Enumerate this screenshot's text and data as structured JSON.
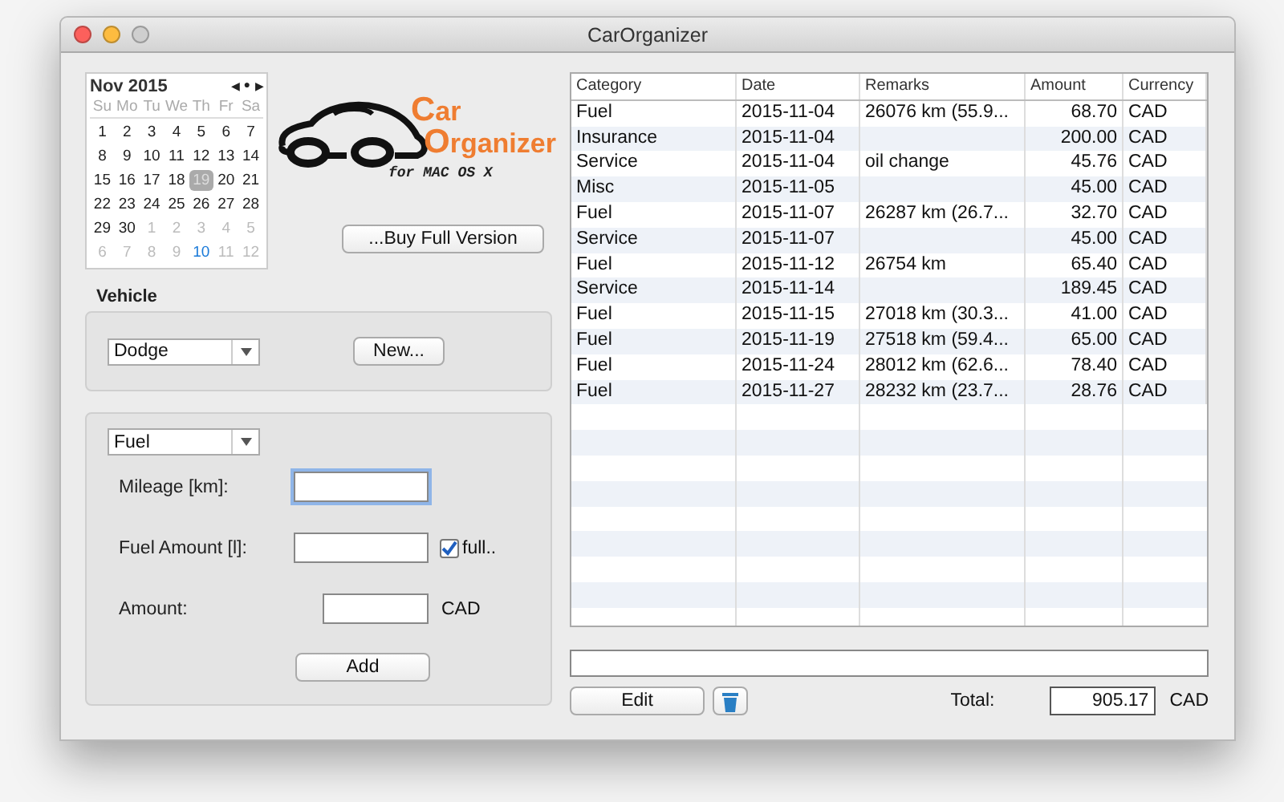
{
  "window": {
    "title": "CarOrganizer"
  },
  "calendar": {
    "month": "Nov 2015",
    "nav": [
      "◀",
      "●",
      "▶"
    ],
    "weekdays": [
      "Su",
      "Mo",
      "Tu",
      "We",
      "Th",
      "Fr",
      "Sa"
    ],
    "weeks": [
      [
        {
          "label": "1",
          "kind": "in",
          "selected": false
        },
        {
          "label": "2",
          "kind": "in",
          "selected": false
        },
        {
          "label": "3",
          "kind": "in",
          "selected": false
        },
        {
          "label": "4",
          "kind": "in",
          "selected": false
        },
        {
          "label": "5",
          "kind": "in",
          "selected": false
        },
        {
          "label": "6",
          "kind": "in",
          "selected": false
        },
        {
          "label": "7",
          "kind": "in",
          "selected": false
        }
      ],
      [
        {
          "label": "8",
          "kind": "in",
          "selected": false
        },
        {
          "label": "9",
          "kind": "in",
          "selected": false
        },
        {
          "label": "10",
          "kind": "in",
          "selected": false
        },
        {
          "label": "11",
          "kind": "in",
          "selected": false
        },
        {
          "label": "12",
          "kind": "in",
          "selected": false
        },
        {
          "label": "13",
          "kind": "in",
          "selected": false
        },
        {
          "label": "14",
          "kind": "in",
          "selected": false
        }
      ],
      [
        {
          "label": "15",
          "kind": "in",
          "selected": false
        },
        {
          "label": "16",
          "kind": "in",
          "selected": false
        },
        {
          "label": "17",
          "kind": "in",
          "selected": false
        },
        {
          "label": "18",
          "kind": "in",
          "selected": false
        },
        {
          "label": "19",
          "kind": "in",
          "selected": true
        },
        {
          "label": "20",
          "kind": "in",
          "selected": false
        },
        {
          "label": "21",
          "kind": "in",
          "selected": false
        }
      ],
      [
        {
          "label": "22",
          "kind": "in",
          "selected": false
        },
        {
          "label": "23",
          "kind": "in",
          "selected": false
        },
        {
          "label": "24",
          "kind": "in",
          "selected": false
        },
        {
          "label": "25",
          "kind": "in",
          "selected": false
        },
        {
          "label": "26",
          "kind": "in",
          "selected": false
        },
        {
          "label": "27",
          "kind": "in",
          "selected": false
        },
        {
          "label": "28",
          "kind": "in",
          "selected": false
        }
      ],
      [
        {
          "label": "29",
          "kind": "in",
          "selected": false
        },
        {
          "label": "30",
          "kind": "in",
          "selected": false
        },
        {
          "label": "1",
          "kind": "out",
          "selected": false
        },
        {
          "label": "2",
          "kind": "out",
          "selected": false
        },
        {
          "label": "3",
          "kind": "out",
          "selected": false
        },
        {
          "label": "4",
          "kind": "out",
          "selected": false
        },
        {
          "label": "5",
          "kind": "out",
          "selected": false
        }
      ],
      [
        {
          "label": "6",
          "kind": "out",
          "selected": false
        },
        {
          "label": "7",
          "kind": "out",
          "selected": false
        },
        {
          "label": "8",
          "kind": "out",
          "selected": false
        },
        {
          "label": "9",
          "kind": "out",
          "selected": false
        },
        {
          "label": "10",
          "kind": "today",
          "selected": false
        },
        {
          "label": "11",
          "kind": "out",
          "selected": false
        },
        {
          "label": "12",
          "kind": "out",
          "selected": false
        }
      ]
    ]
  },
  "logo": {
    "line1": "Car",
    "line2": "Organizer",
    "tagline": "for MAC OS X"
  },
  "buy_button": "...Buy Full Version",
  "vehicle": {
    "title": "Vehicle",
    "selection": "Dodge",
    "new_button": "New..."
  },
  "entry": {
    "category": "Fuel",
    "mileage_label": "Mileage [km]:",
    "fuel_label": "Fuel Amount [l]:",
    "full": {
      "label": "full..",
      "checked": true
    },
    "amount_label": "Amount:",
    "currency": "CAD",
    "add_button": "Add"
  },
  "table": {
    "columns": [
      "Category",
      "Date",
      "Remarks",
      "Amount",
      "Currency"
    ],
    "rows": [
      [
        "Fuel",
        "2015-11-04",
        "26076 km (55.9...",
        "68.70",
        "CAD"
      ],
      [
        "Insurance",
        "2015-11-04",
        "",
        "200.00",
        "CAD"
      ],
      [
        "Service",
        "2015-11-04",
        "oil change",
        "45.76",
        "CAD"
      ],
      [
        "Misc",
        "2015-11-05",
        "",
        "45.00",
        "CAD"
      ],
      [
        "Fuel",
        "2015-11-07",
        "26287 km (26.7...",
        "32.70",
        "CAD"
      ],
      [
        "Service",
        "2015-11-07",
        "",
        "45.00",
        "CAD"
      ],
      [
        "Fuel",
        "2015-11-12",
        "26754 km",
        "65.40",
        "CAD"
      ],
      [
        "Service",
        "2015-11-14",
        "",
        "189.45",
        "CAD"
      ],
      [
        "Fuel",
        "2015-11-15",
        "27018 km (30.3...",
        "41.00",
        "CAD"
      ],
      [
        "Fuel",
        "2015-11-19",
        "27518 km (59.4...",
        "65.00",
        "CAD"
      ],
      [
        "Fuel",
        "2015-11-24",
        "28012 km (62.6...",
        "78.40",
        "CAD"
      ],
      [
        "Fuel",
        "2015-11-27",
        "28232 km (23.7...",
        "28.76",
        "CAD"
      ]
    ]
  },
  "edit_button": "Edit",
  "total": {
    "label": "Total:",
    "value": "905.17",
    "currency": "CAD"
  }
}
